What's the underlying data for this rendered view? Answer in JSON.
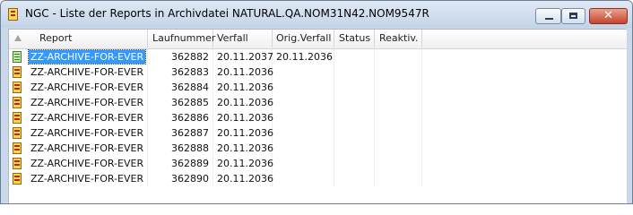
{
  "window": {
    "title": "NGC - Liste der Reports in Archivdatei NATURAL.QA.NOM31N42.NOM9547R",
    "close_glyph": "✕"
  },
  "columns": {
    "report": "Report",
    "laufnummer": "Laufnummer",
    "verfall": "Verfall",
    "orig_verfall": "Orig.Verfall",
    "status": "Status",
    "reaktiv": "Reaktiv."
  },
  "rows": [
    {
      "report": "ZZ-ARCHIVE-FOR-EVER",
      "laufnummer": "362882",
      "verfall": "20.11.2037",
      "orig_verfall": "20.11.2036",
      "status": "",
      "reaktiv": ""
    },
    {
      "report": "ZZ-ARCHIVE-FOR-EVER",
      "laufnummer": "362883",
      "verfall": "20.11.2036",
      "orig_verfall": "",
      "status": "",
      "reaktiv": ""
    },
    {
      "report": "ZZ-ARCHIVE-FOR-EVER",
      "laufnummer": "362884",
      "verfall": "20.11.2036",
      "orig_verfall": "",
      "status": "",
      "reaktiv": ""
    },
    {
      "report": "ZZ-ARCHIVE-FOR-EVER",
      "laufnummer": "362885",
      "verfall": "20.11.2036",
      "orig_verfall": "",
      "status": "",
      "reaktiv": ""
    },
    {
      "report": "ZZ-ARCHIVE-FOR-EVER",
      "laufnummer": "362886",
      "verfall": "20.11.2036",
      "orig_verfall": "",
      "status": "",
      "reaktiv": ""
    },
    {
      "report": "ZZ-ARCHIVE-FOR-EVER",
      "laufnummer": "362887",
      "verfall": "20.11.2036",
      "orig_verfall": "",
      "status": "",
      "reaktiv": ""
    },
    {
      "report": "ZZ-ARCHIVE-FOR-EVER",
      "laufnummer": "362888",
      "verfall": "20.11.2036",
      "orig_verfall": "",
      "status": "",
      "reaktiv": ""
    },
    {
      "report": "ZZ-ARCHIVE-FOR-EVER",
      "laufnummer": "362889",
      "verfall": "20.11.2036",
      "orig_verfall": "",
      "status": "",
      "reaktiv": ""
    },
    {
      "report": "ZZ-ARCHIVE-FOR-EVER",
      "laufnummer": "362890",
      "verfall": "20.11.2036",
      "orig_verfall": "",
      "status": "",
      "reaktiv": ""
    }
  ],
  "row_icons": [
    "green-report-icon",
    "report-icon",
    "report-icon",
    "report-icon",
    "report-icon",
    "report-icon",
    "report-icon",
    "report-icon",
    "report-icon"
  ],
  "colors": {
    "selection": "#3399ff",
    "titlebar": "#c9d8ea",
    "close_button": "#c5432d"
  }
}
